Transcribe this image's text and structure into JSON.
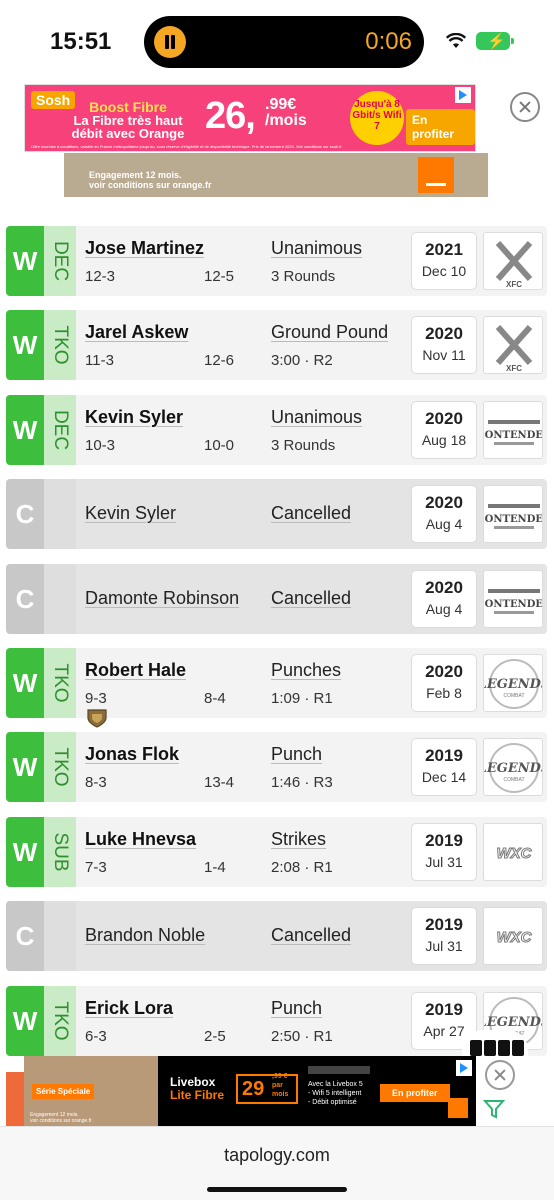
{
  "status": {
    "time": "15:51",
    "recording_timer": "0:06",
    "battery_color": "#35c759"
  },
  "ad_top": {
    "brand": "Sosh",
    "headline_1": "Boost Fibre",
    "headline_2": "La Fibre très haut débit avec Orange",
    "price": "26,",
    "cents": ".99€",
    "per": "/mois",
    "badge": "Jusqu'à 8 Gbit/s Wifi 7",
    "cta": "En profiter",
    "fine_print": "Offre soumise à conditions, valable en France métropolitaine jusqu'au, sous réserve d'éligibilité et de disponibilité technique. Prix de lancement 2025. Voir conditions sur sosh.fr",
    "sub_text_1": "Engagement 12 mois.",
    "sub_text_2": "voir conditions sur orange.fr"
  },
  "fights": [
    {
      "result": "W",
      "method": "DEC",
      "opponent": "Jose Martinez",
      "record": "12-3",
      "opp_record": "12-5",
      "finish": "Unanimous",
      "detail": "3 Rounds",
      "year": "2021",
      "date": "Dec 10",
      "promotion": "XFC",
      "cancelled": false
    },
    {
      "result": "W",
      "method": "TKO",
      "opponent": "Jarel Askew",
      "record": "11-3",
      "opp_record": "12-6",
      "finish": "Ground Pound",
      "detail": "3:00 · R2",
      "year": "2020",
      "date": "Nov 11",
      "promotion": "XFC",
      "cancelled": false
    },
    {
      "result": "W",
      "method": "DEC",
      "opponent": "Kevin Syler",
      "record": "10-3",
      "opp_record": "10-0",
      "finish": "Unanimous",
      "detail": "3 Rounds",
      "year": "2020",
      "date": "Aug 18",
      "promotion": "CONTENDER",
      "cancelled": false
    },
    {
      "result": "C",
      "method": "",
      "opponent": "Kevin Syler",
      "record": "",
      "opp_record": "",
      "finish": "Cancelled",
      "detail": "",
      "year": "2020",
      "date": "Aug 4",
      "promotion": "CONTENDER",
      "cancelled": true
    },
    {
      "result": "C",
      "method": "",
      "opponent": "Damonte Robinson",
      "record": "",
      "opp_record": "",
      "finish": "Cancelled",
      "detail": "",
      "year": "2020",
      "date": "Aug 4",
      "promotion": "CONTENDER",
      "cancelled": true
    },
    {
      "result": "W",
      "method": "TKO",
      "opponent": "Robert Hale",
      "record": "9-3",
      "opp_record": "8-4",
      "finish": "Punches",
      "detail": "1:09 · R1",
      "year": "2020",
      "date": "Feb 8",
      "promotion": "LEGENDS",
      "cancelled": false,
      "title_fight": true
    },
    {
      "result": "W",
      "method": "TKO",
      "opponent": "Jonas Flok",
      "record": "8-3",
      "opp_record": "13-4",
      "finish": "Punch",
      "detail": "1:46 · R3",
      "year": "2019",
      "date": "Dec 14",
      "promotion": "LEGENDS",
      "cancelled": false
    },
    {
      "result": "W",
      "method": "SUB",
      "opponent": "Luke Hnevsa",
      "record": "7-3",
      "opp_record": "1-4",
      "finish": "Strikes",
      "detail": "2:08 · R1",
      "year": "2019",
      "date": "Jul 31",
      "promotion": "WXC",
      "cancelled": false
    },
    {
      "result": "C",
      "method": "",
      "opponent": "Brandon Noble",
      "record": "",
      "opp_record": "",
      "finish": "Cancelled",
      "detail": "",
      "year": "2019",
      "date": "Jul 31",
      "promotion": "WXC",
      "cancelled": true
    },
    {
      "result": "W",
      "method": "TKO",
      "opponent": "Erick Lora",
      "record": "6-3",
      "opp_record": "2-5",
      "finish": "Punch",
      "detail": "2:50 · R1",
      "year": "2019",
      "date": "Apr 27",
      "promotion": "LEGENDS",
      "cancelled": false
    }
  ],
  "ad_bottom": {
    "serie": "Série Spéciale",
    "fine_1": "Engagement 12 mois.",
    "fine_2": "voir conditions sur orange.fr",
    "title_1": "Livebox",
    "title_2": "Lite Fibre",
    "price": "29",
    "price_small_1": ",99 €",
    "price_small_2": "par mois",
    "feat_1": "Avec la Livebox 5",
    "feat_2": "- Wifi 5 intelligent",
    "feat_3": "- Débit optimisé",
    "cta": "En profiter"
  },
  "url": "tapology.com",
  "colors": {
    "win": "#3dbf3d",
    "win_method_bg": "#c9ebc5",
    "cancel": "#c8c8c8",
    "orange": "#ff7900"
  }
}
